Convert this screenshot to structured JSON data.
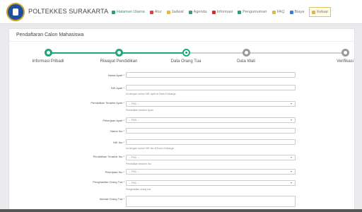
{
  "header": {
    "brand": "POLTEKKES SURAKARTA",
    "nav": [
      {
        "label": "Halaman Utama",
        "icon": "home-icon",
        "color": "#2e9d78",
        "active": true
      },
      {
        "label": "Alur",
        "icon": "check-icon",
        "color": "#d64541",
        "active": false
      },
      {
        "label": "Jadwal",
        "icon": "calendar-icon",
        "color": "#e2b93b",
        "active": false
      },
      {
        "label": "Agenda",
        "icon": "agenda-icon",
        "color": "#2e9d78",
        "active": false
      },
      {
        "label": "Informasi",
        "icon": "info-icon",
        "color": "#c9302c",
        "active": false
      },
      {
        "label": "Pengumuman",
        "icon": "megaphone-icon",
        "color": "#2e9d78",
        "active": false
      },
      {
        "label": "FAQ",
        "icon": "faq-icon",
        "color": "#e2b93b",
        "active": false
      },
      {
        "label": "Biaya",
        "icon": "money-icon",
        "color": "#3a7bd5",
        "active": false
      },
      {
        "label": "Keluar",
        "icon": "logout-icon",
        "color": "#e2b93b",
        "active": false
      }
    ]
  },
  "panel": {
    "title": "Pendaftaran Calon Mahasiswa"
  },
  "steps": [
    {
      "label": "Informasi Pribadi",
      "state": "done"
    },
    {
      "label": "Riwayat Pendidikan",
      "state": "done"
    },
    {
      "label": "Data Orang Tua",
      "state": "current"
    },
    {
      "label": "Data Wali",
      "state": "todo"
    },
    {
      "label": "Verifikasi",
      "state": "todo"
    }
  ],
  "form": {
    "nama_ayah": {
      "label": "Nama Ayah *",
      "value": ""
    },
    "nik_ayah": {
      "label": "NIK Ayah *",
      "value": "",
      "help": "Isi dengan nomor NIK ayah di Kartu Keluarga"
    },
    "pendidikan_ayah": {
      "label": "Pendidikan Terakhir Ayah *",
      "value": "-- Pilih --",
      "help": "Pendidikan terakhir Ayah"
    },
    "pekerjaan_ayah": {
      "label": "Pekerjaan Ayah *",
      "value": "-- Pilih --"
    },
    "nama_ibu": {
      "label": "Nama Ibu *",
      "value": ""
    },
    "nik_ibu": {
      "label": "NIK Ibu *",
      "value": "",
      "help": "Isi dengan nomor NIK ibu di Kartu Keluarga"
    },
    "pendidikan_ibu": {
      "label": "Pendidikan Terakhir Ibu *",
      "value": "-- Pilih --",
      "help": "Pendidikan terakhir Ibu"
    },
    "pekerjaan_ibu": {
      "label": "Pekerjaan Ibu *",
      "value": "-- Pilih --"
    },
    "penghasilan": {
      "label": "Penghasilan Orang Tua *",
      "value": "-- Pilih --",
      "help": "Penghasilan orang tua"
    },
    "alamat": {
      "label": "Alamat Orang Tua *",
      "value": ""
    }
  }
}
